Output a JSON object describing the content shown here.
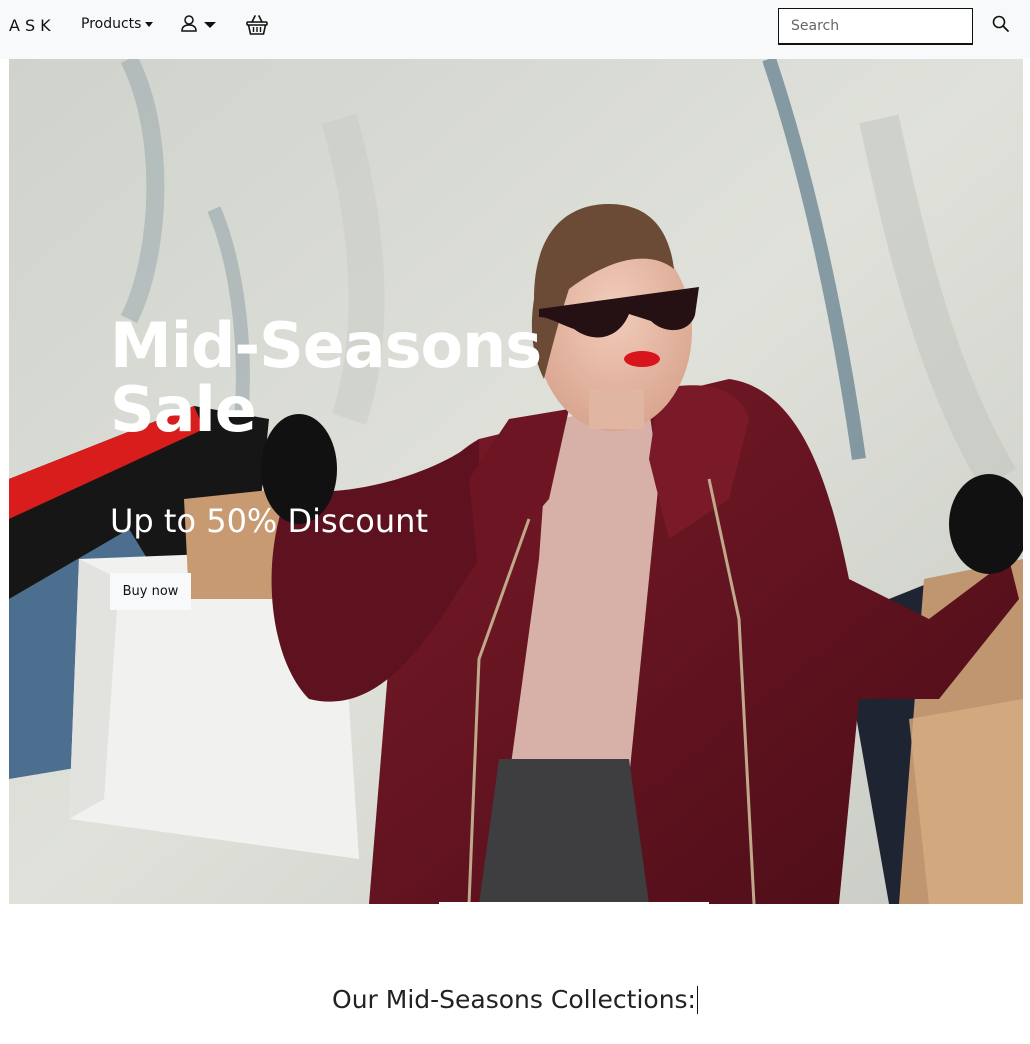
{
  "navbar": {
    "brand": "ASK",
    "products_label": "Products",
    "user_menu_icon": "user-icon",
    "cart_icon": "basket-icon",
    "search": {
      "placeholder": "Search",
      "value": "",
      "button_icon": "search-icon"
    }
  },
  "hero": {
    "title": "Mid-Seasons Sale",
    "subtitle": "Up to 50% Discount",
    "cta_label": "Buy now",
    "image_description_icon": "woman-with-shopping-bags-photo"
  },
  "collections": {
    "heading": "Our Mid-Seasons Collections:"
  },
  "colors": {
    "navbar_bg": "#f8f9fa",
    "coat": "#6a1421",
    "hero_text": "#ffffff"
  }
}
